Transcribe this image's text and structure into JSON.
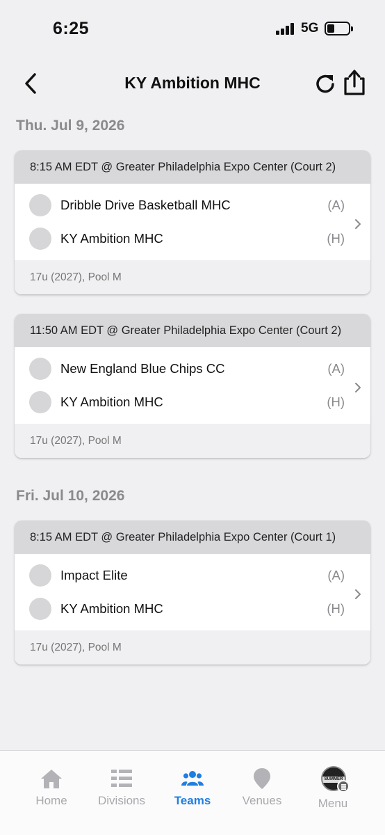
{
  "status_bar": {
    "time": "6:25",
    "network": "5G"
  },
  "header": {
    "title": "KY Ambition MHC"
  },
  "days": [
    {
      "heading": "Thu. Jul 9, 2026",
      "games": [
        {
          "time_venue": "8:15 AM EDT @ Greater Philadelphia Expo Center (Court 2)",
          "teams": [
            {
              "name": "Dribble Drive Basketball MHC",
              "side": "(A)"
            },
            {
              "name": "KY Ambition MHC",
              "side": "(H)"
            }
          ],
          "division": "17u (2027), Pool M"
        },
        {
          "time_venue": "11:50 AM EDT @ Greater Philadelphia Expo Center (Court 2)",
          "teams": [
            {
              "name": "New England Blue Chips CC",
              "side": "(A)"
            },
            {
              "name": "KY Ambition MHC",
              "side": "(H)"
            }
          ],
          "division": "17u (2027), Pool M"
        }
      ]
    },
    {
      "heading": "Fri. Jul 10, 2026",
      "games": [
        {
          "time_venue": "8:15 AM EDT @ Greater Philadelphia Expo Center (Court 1)",
          "teams": [
            {
              "name": "Impact Elite",
              "side": "(A)"
            },
            {
              "name": "KY Ambition MHC",
              "side": "(H)"
            }
          ],
          "division": "17u (2027), Pool M"
        }
      ]
    }
  ],
  "tabbar": {
    "home": "Home",
    "divisions": "Divisions",
    "teams": "Teams",
    "venues": "Venues",
    "menu": "Menu",
    "menu_logo_text": "SUMMER"
  },
  "colors": {
    "accent": "#1e7fe0",
    "inactive": "#a9a9ad",
    "card_header": "#d8d8da",
    "background": "#f0f0f2"
  }
}
